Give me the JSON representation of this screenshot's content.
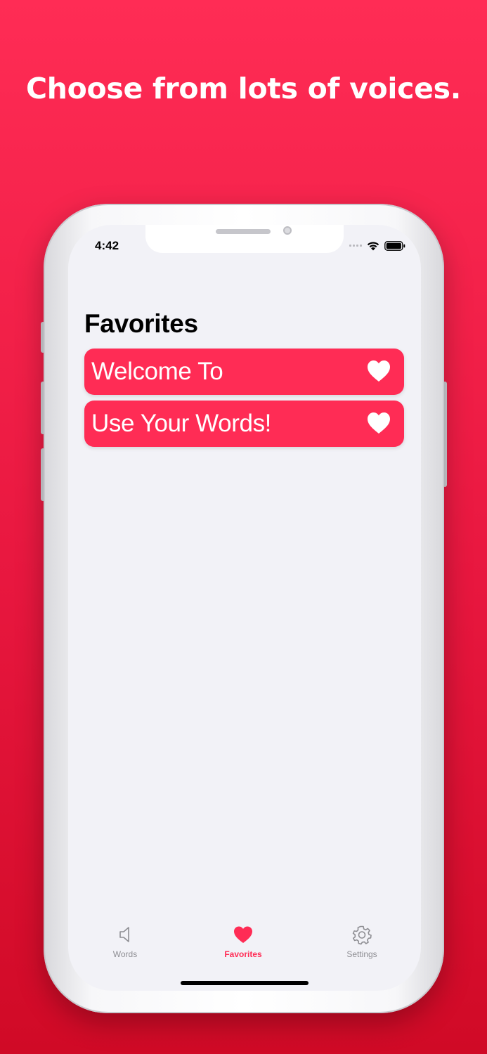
{
  "headline": "Choose from lots of voices.",
  "status_bar": {
    "time": "4:42"
  },
  "screen": {
    "title": "Favorites",
    "favorites": [
      {
        "label": "Welcome To"
      },
      {
        "label": "Use Your Words!"
      }
    ]
  },
  "tab_bar": {
    "tabs": [
      {
        "label": "Words",
        "icon": "speaker-icon",
        "active": false
      },
      {
        "label": "Favorites",
        "icon": "heart-icon",
        "active": true
      },
      {
        "label": "Settings",
        "icon": "gear-icon",
        "active": false
      }
    ]
  },
  "colors": {
    "accent": "#ff2c55",
    "background_top": "#ff2c55",
    "background_bottom": "#d00a26",
    "screen_background": "#f2f2f7",
    "inactive_tab": "#8e8e93"
  }
}
